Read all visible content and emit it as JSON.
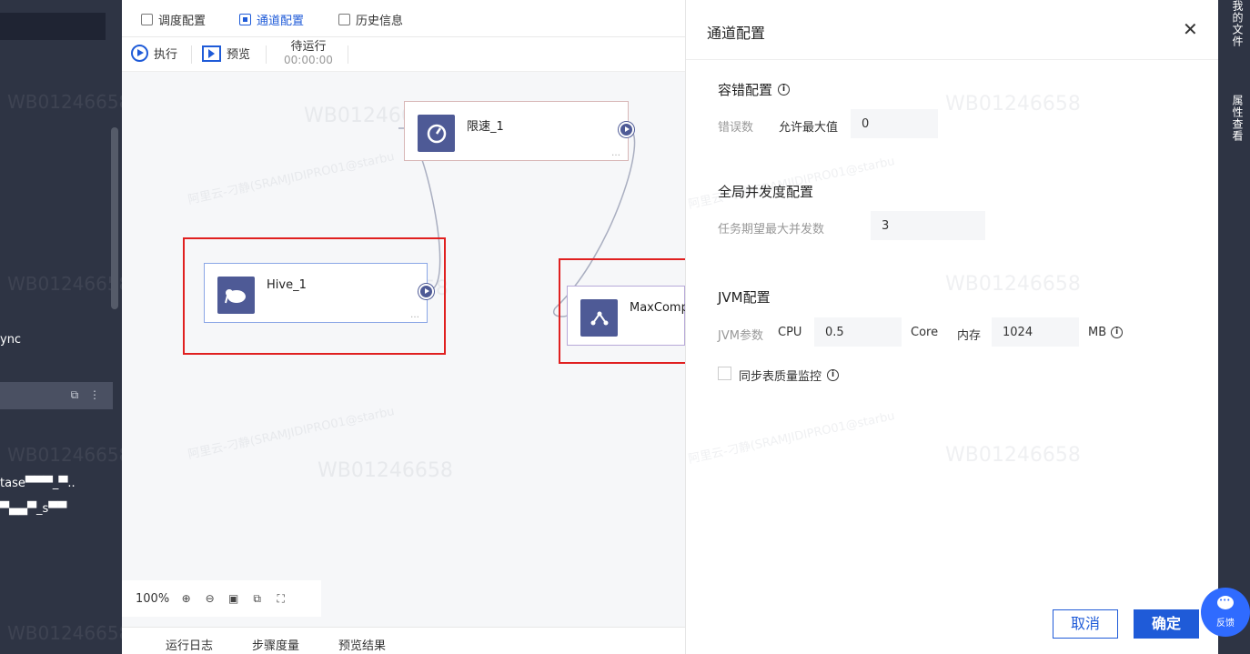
{
  "sidebar": {
    "item_ync": "ync",
    "item_tase": "tase▀▀▀_▀..",
    "item_blur": "▀▄▄▀_s▀▀",
    "row_icons": "⧉ ⋮",
    "watermarks": [
      "WB01246658",
      "WB01246658",
      "WB01246658",
      "WB01246658"
    ]
  },
  "tabs": [
    {
      "label": "调度配置",
      "icon": "schedule-config-icon"
    },
    {
      "label": "通道配置",
      "icon": "channel-config-icon",
      "active": true
    },
    {
      "label": "历史信息",
      "icon": "history-icon"
    }
  ],
  "toolbar": {
    "run_label": "执行",
    "preview_label": "预览",
    "status_label": "待运行",
    "status_time": "00:00:00"
  },
  "nodes": {
    "limit": {
      "label": "限速_1",
      "icon": "speed-gauge-icon"
    },
    "hive": {
      "label": "Hive_1",
      "icon": "hive-elephant-icon"
    },
    "maxcompute": {
      "label": "MaxComp",
      "icon": "maxcompute-icon"
    }
  },
  "watermarks": {
    "id": "WB01246658",
    "user": "阿里云-刁静(SRAMJIDIPRO01@starbu"
  },
  "zoom": {
    "level": "100%"
  },
  "bottom_tabs": [
    "运行日志",
    "步骤度量",
    "预览结果"
  ],
  "panel": {
    "title": "通道配置",
    "close": "✕",
    "fault_section": "容错配置",
    "error_count_label": "错误数",
    "allow_max_label": "允许最大值",
    "allow_max_value": "0",
    "concurrency_section": "全局并发度配置",
    "expected_concurrency_label": "任务期望最大并发数",
    "expected_concurrency_value": "3",
    "jvm_section": "JVM配置",
    "jvm_param_label": "JVM参数",
    "cpu_label": "CPU",
    "cpu_value": "0.5",
    "cpu_unit": "Core",
    "mem_label": "内存",
    "mem_value": "1024",
    "mem_unit": "MB",
    "sync_quality_label": "同步表质量监控",
    "cancel": "取消",
    "ok": "确定"
  },
  "right_strip": {
    "my_files": "我的文件",
    "properties": "属性查看"
  },
  "feedback": {
    "label": "反馈"
  },
  "colors": {
    "accent": "#1f5bd8",
    "node_icon": "#4e5a96",
    "highlight": "#e02020",
    "sidebar": "#2e3444"
  }
}
